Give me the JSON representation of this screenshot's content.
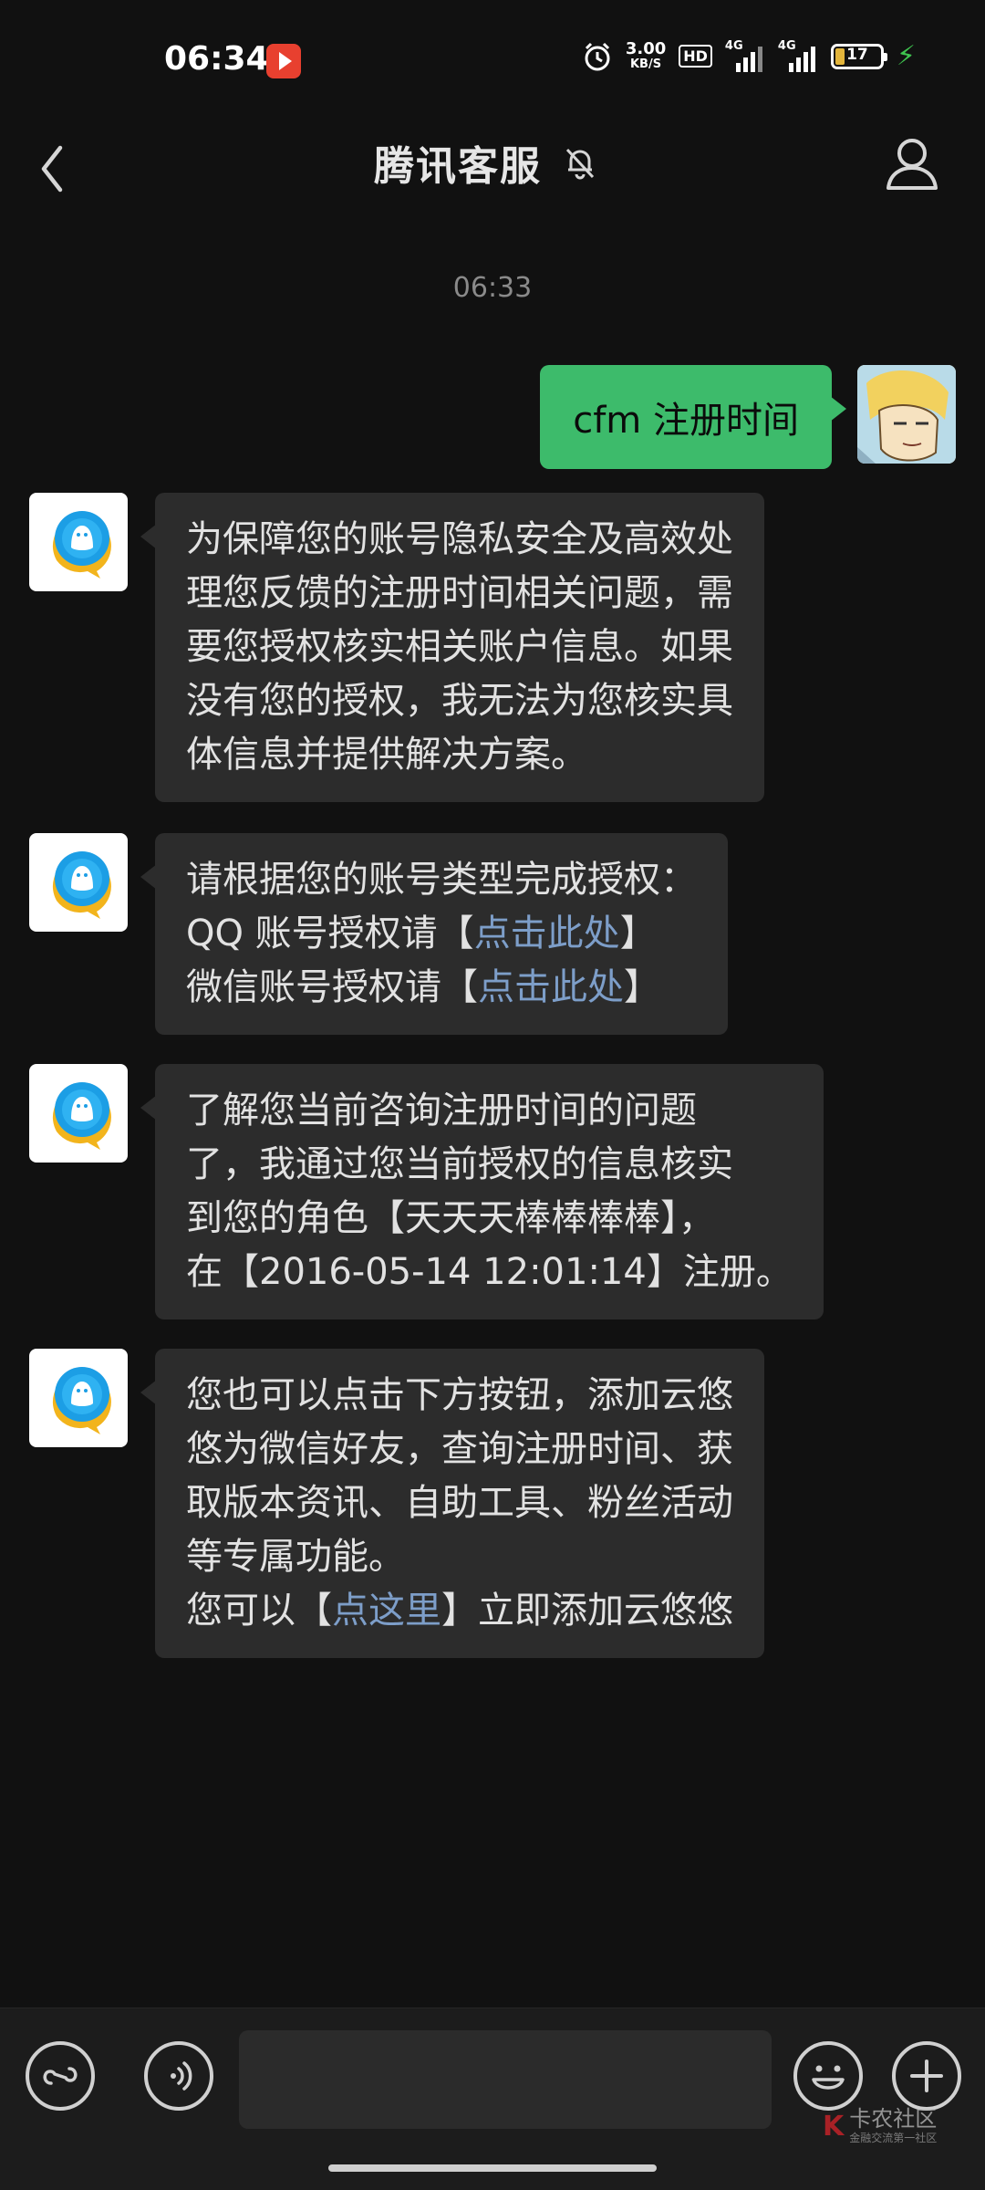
{
  "status_bar": {
    "time": "06:34",
    "net_speed_value": "3.00",
    "net_speed_unit": "KB/S",
    "hd_badge": "HD",
    "signal_1": "4G",
    "signal_2": "4G",
    "battery_level": "17",
    "icons": [
      "video-app-icon",
      "alarm-icon",
      "hd-icon",
      "signal-icon",
      "signal-icon",
      "battery-icon",
      "charging-icon"
    ]
  },
  "header": {
    "title": "腾讯客服",
    "icons": [
      "back-arrow-icon",
      "mute-bell-icon",
      "profile-icon"
    ]
  },
  "chat": {
    "timestamp": "06:33",
    "outgoing": {
      "text": "cfm 注册时间"
    },
    "incoming": [
      {
        "lines": [
          "为保障您的账号隐私安全及高效处",
          "理您反馈的注册时间相关问题，需",
          "要您授权核实相关账户信息。如果",
          "没有您的授权，我无法为您核实具",
          "体信息并提供解决方案。"
        ]
      },
      {
        "line1": "请根据您的账号类型完成授权：",
        "line2_prefix": "QQ 账号授权请【",
        "line2_link": "点击此处",
        "line2_suffix": "】",
        "line3_prefix": "微信账号授权请【",
        "line3_link": "点击此处",
        "line3_suffix": "】"
      },
      {
        "lines": [
          "了解您当前咨询注册时间的问题",
          "了，我通过您当前授权的信息核实",
          "到您的角色【天天天棒棒棒棒】，",
          "在【2016-05-14 12:01:14】注册。"
        ]
      },
      {
        "lines": [
          "您也可以点击下方按钮，添加云悠",
          "悠为微信好友，查询注册时间、获",
          "取版本资讯、自助工具、粉丝活动",
          "等专属功能。"
        ],
        "last_prefix": "您可以【",
        "last_link": "点这里",
        "last_suffix": "】立即添加云悠悠"
      }
    ]
  },
  "bottom_bar": {
    "input_value": "",
    "icons": [
      "mini-program-icon",
      "voice-icon",
      "emoji-icon",
      "plus-icon"
    ]
  },
  "watermark": {
    "text": "卡农社区",
    "subtext": "金融交流第一社区"
  },
  "colors": {
    "background": "#111111",
    "outgoing_bubble": "#3dbb6b",
    "incoming_bubble": "#2c2c2c",
    "link": "#7d9ec9"
  }
}
